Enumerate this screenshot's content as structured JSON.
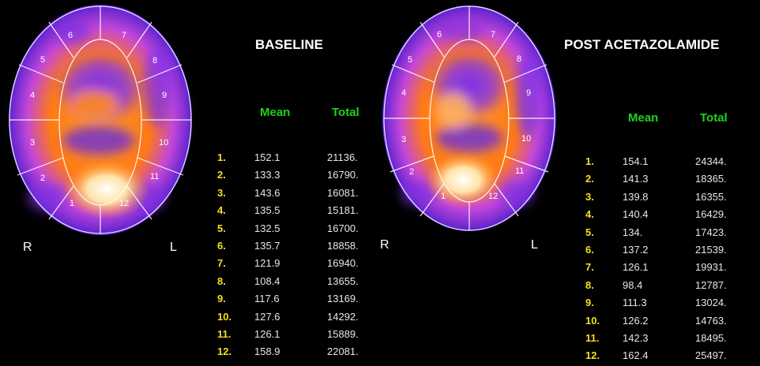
{
  "panels": [
    {
      "title": "BASELINE",
      "mean_header": "Mean",
      "total_header": "Total",
      "r_label": "R",
      "l_label": "L",
      "segments": [
        "1",
        "2",
        "3",
        "4",
        "5",
        "6",
        "7",
        "8",
        "9",
        "10",
        "11",
        "12"
      ],
      "rows": [
        {
          "idx": "1.",
          "mean": "152.1",
          "total": "21136."
        },
        {
          "idx": "2.",
          "mean": "133.3",
          "total": "16790."
        },
        {
          "idx": "3.",
          "mean": "143.6",
          "total": "16081."
        },
        {
          "idx": "4.",
          "mean": "135.5",
          "total": "15181."
        },
        {
          "idx": "5.",
          "mean": "132.5",
          "total": "16700."
        },
        {
          "idx": "6.",
          "mean": "135.7",
          "total": "18858."
        },
        {
          "idx": "7.",
          "mean": "121.9",
          "total": "16940."
        },
        {
          "idx": "8.",
          "mean": "108.4",
          "total": "13655."
        },
        {
          "idx": "9.",
          "mean": "117.6",
          "total": "13169."
        },
        {
          "idx": "10.",
          "mean": "127.6",
          "total": "14292."
        },
        {
          "idx": "11.",
          "mean": "126.1",
          "total": "15889."
        },
        {
          "idx": "12.",
          "mean": "158.9",
          "total": "22081."
        }
      ]
    },
    {
      "title": "POST ACETAZOLAMIDE",
      "mean_header": "Mean",
      "total_header": "Total",
      "r_label": "R",
      "l_label": "L",
      "segments": [
        "1",
        "2",
        "3",
        "4",
        "5",
        "6",
        "7",
        "8",
        "9",
        "10",
        "11",
        "12"
      ],
      "rows": [
        {
          "idx": "1.",
          "mean": "154.1",
          "total": "24344."
        },
        {
          "idx": "2.",
          "mean": "141.3",
          "total": "18365."
        },
        {
          "idx": "3.",
          "mean": "139.8",
          "total": "16355."
        },
        {
          "idx": "4.",
          "mean": "140.4",
          "total": "16429."
        },
        {
          "idx": "5.",
          "mean": "134.",
          "total": "17423."
        },
        {
          "idx": "6.",
          "mean": "137.2",
          "total": "21539."
        },
        {
          "idx": "7.",
          "mean": "126.1",
          "total": "19931."
        },
        {
          "idx": "8.",
          "mean": "98.4",
          "total": "12787."
        },
        {
          "idx": "9.",
          "mean": "111.3",
          "total": "13024."
        },
        {
          "idx": "10.",
          "mean": "126.2",
          "total": "14763."
        },
        {
          "idx": "11.",
          "mean": "142.3",
          "total": "18495."
        },
        {
          "idx": "12.",
          "mean": "162.4",
          "total": "25497."
        }
      ]
    }
  ],
  "colors": {
    "header_green": "#1fd21f",
    "index_yellow": "#f2e21a",
    "value_text": "#e6e6e6",
    "scan_orange": "#ff8c1a",
    "scan_purple": "#7a2cf0",
    "scan_white": "#fff6d8",
    "scan_halo": "#2fb89a"
  }
}
